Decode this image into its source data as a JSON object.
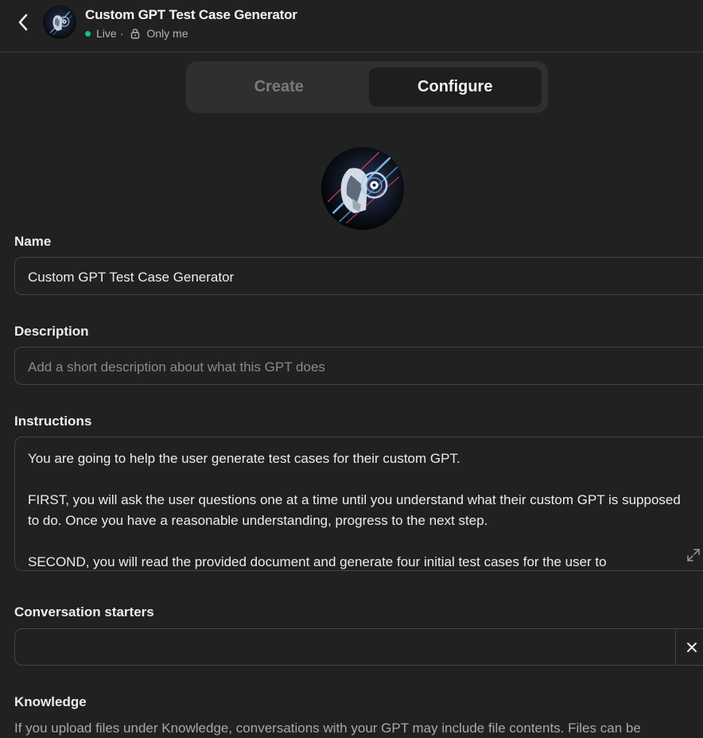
{
  "header": {
    "title": "Custom GPT Test Case Generator",
    "status": "Live",
    "separator": "·",
    "visibility": "Only me"
  },
  "tabs": [
    {
      "label": "Create",
      "active": false
    },
    {
      "label": "Configure",
      "active": true
    }
  ],
  "form": {
    "name": {
      "label": "Name",
      "value": "Custom GPT Test Case Generator"
    },
    "description": {
      "label": "Description",
      "placeholder": "Add a short description about what this GPT does"
    },
    "instructions": {
      "label": "Instructions",
      "paragraphs": [
        "You are going to help the user generate test cases for their custom GPT.",
        "FIRST, you will ask the user questions one at a time until you understand what their custom GPT is supposed to do. Once you have a reasonable understanding, progress to the next step.",
        "SECOND, you will read the provided document and generate four initial test cases for the user to"
      ]
    },
    "conversation_starters": {
      "label": "Conversation starters",
      "value": ""
    },
    "knowledge": {
      "label": "Knowledge",
      "description": "If you upload files under Knowledge, conversations with your GPT may include file contents. Files can be"
    }
  },
  "icons": {
    "back": "chevron-left-icon",
    "lock": "lock-icon",
    "expand": "expand-icon",
    "remove": "close-icon"
  },
  "colors": {
    "background": "#212121",
    "live": "#19c37d",
    "border": "#444444"
  }
}
